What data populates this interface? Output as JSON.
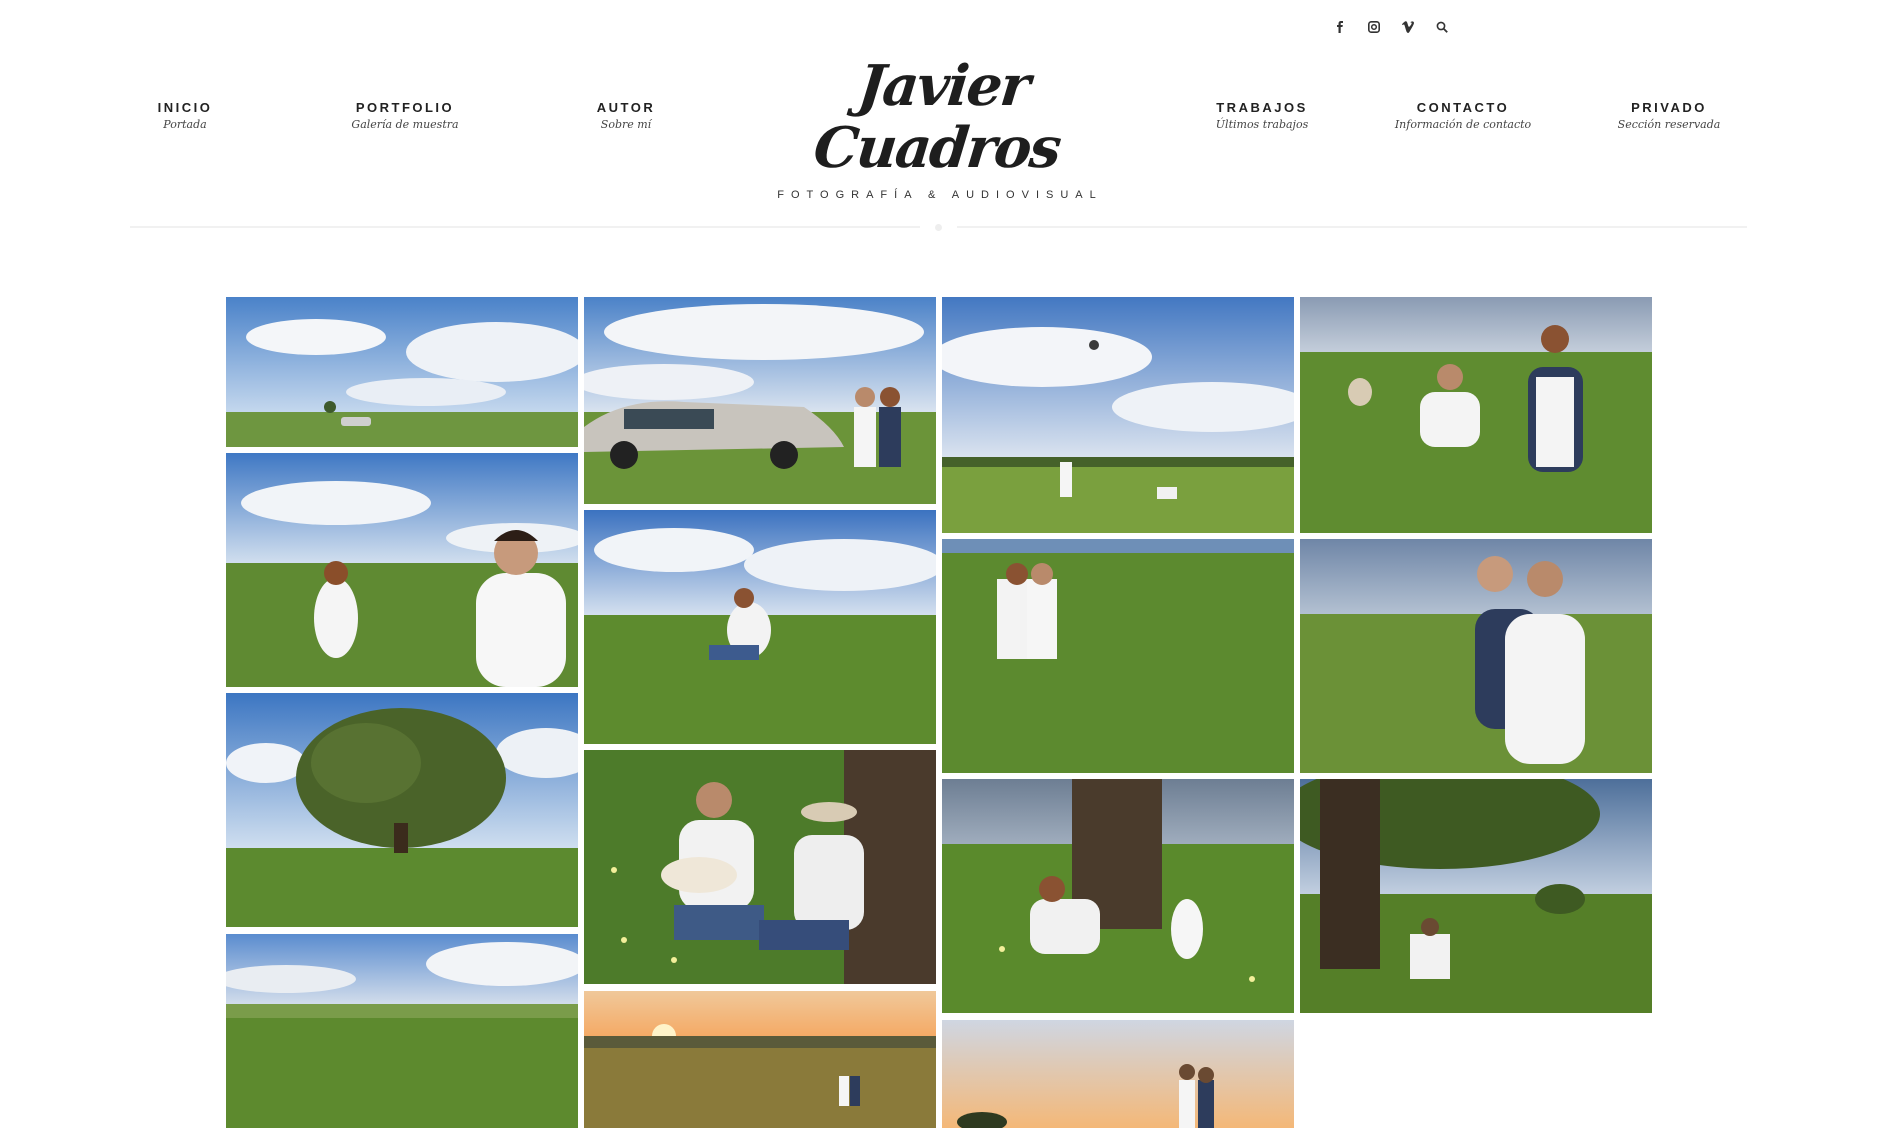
{
  "social": {
    "facebook": "facebook-icon",
    "instagram": "instagram-icon",
    "vimeo": "vimeo-icon",
    "search": "search-icon"
  },
  "nav_left": [
    {
      "label": "INICIO",
      "sub": "Portada"
    },
    {
      "label": "PORTFOLIO",
      "sub": "Galería de muestra"
    },
    {
      "label": "AUTOR",
      "sub": "Sobre mí"
    }
  ],
  "nav_right": [
    {
      "label": "TRABAJOS",
      "sub": "Últimos trabajos"
    },
    {
      "label": "CONTACTO",
      "sub": "Información de contacto"
    },
    {
      "label": "PRIVADO",
      "sub": "Sección reservada"
    }
  ],
  "logo": {
    "script": "Javier Cuadros",
    "tagline": "FOTOGRAFÍA & AUDIOVISUAL"
  },
  "colors": {
    "sky": "#5a8ccf",
    "field": "#6f9a3a",
    "sunset": "#f2b46a",
    "text": "#222222"
  },
  "gallery": [
    {
      "scene": "sky-field",
      "subject": "car in field under clouds"
    },
    {
      "scene": "car",
      "subject": "couple by car"
    },
    {
      "scene": "sky-field",
      "subject": "man throwing hat to sky"
    },
    {
      "scene": "field-close",
      "subject": "couple in wheat field with hat"
    },
    {
      "scene": "field-close",
      "subject": "couple facing each other"
    },
    {
      "scene": "sky-field",
      "subject": "couple sitting in wheat"
    },
    {
      "scene": "field-close",
      "subject": "couple embracing"
    },
    {
      "scene": "field-close",
      "subject": "couple hugging"
    },
    {
      "scene": "tree",
      "subject": "large oak tree"
    },
    {
      "scene": "flowers",
      "subject": "couple with guitar"
    },
    {
      "scene": "flowers",
      "subject": "couple under tree trunk"
    },
    {
      "scene": "tree-dark",
      "subject": "couple under oak at dusk"
    },
    {
      "scene": "landscape",
      "subject": "green landscape"
    },
    {
      "scene": "sunset",
      "subject": "sunset field"
    },
    {
      "scene": "sunset",
      "subject": "couple at sunset"
    }
  ]
}
